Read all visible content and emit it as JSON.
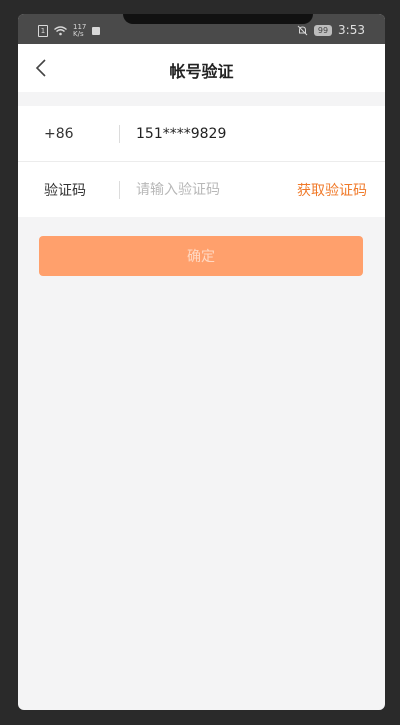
{
  "statusbar": {
    "net_speed_value": "117",
    "net_speed_unit": "K/s",
    "battery": "99",
    "time": "3:53"
  },
  "header": {
    "title": "帐号验证",
    "back_icon": "chevron-left-icon"
  },
  "form": {
    "phone": {
      "country_code": "+86",
      "number": "151****9829"
    },
    "code": {
      "label": "验证码",
      "placeholder": "请输入验证码",
      "value": "",
      "get_code_label": "获取验证码"
    }
  },
  "confirm": {
    "label": "确定"
  },
  "colors": {
    "accent": "#f07a2a",
    "button_bg": "#ffa06c",
    "page_bg": "#f4f4f5"
  }
}
